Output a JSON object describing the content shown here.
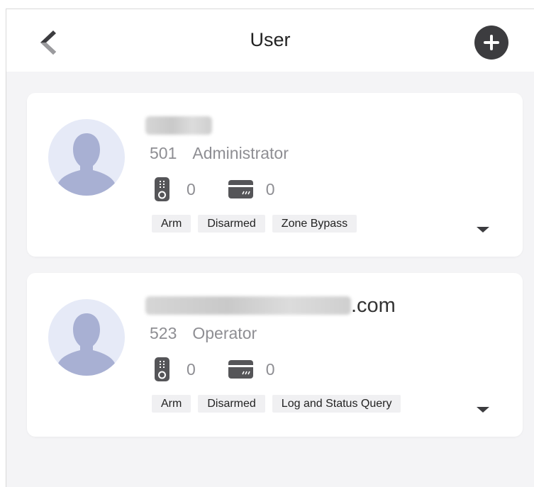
{
  "header": {
    "title": "User"
  },
  "users": [
    {
      "name_suffix": "",
      "id": "501",
      "role": "Administrator",
      "remote_count": "0",
      "card_count": "0",
      "permissions": [
        "Arm",
        "Disarmed",
        "Zone Bypass"
      ]
    },
    {
      "name_suffix": ".com",
      "id": "523",
      "role": "Operator",
      "remote_count": "0",
      "card_count": "0",
      "permissions": [
        "Arm",
        "Disarmed",
        "Log and Status Query"
      ]
    }
  ],
  "icons": {
    "back": "back-chevron-icon",
    "add": "plus-icon",
    "remote": "remote-control-icon",
    "card": "card-icon",
    "expand": "caret-down-icon",
    "avatar": "user-silhouette-icon"
  },
  "colors": {
    "background": "#f4f4f6",
    "card": "#ffffff",
    "avatar_bg": "#e6eaf7",
    "avatar_figure": "#a8b0d3",
    "icon_dark": "#3c3c3f",
    "secondary_text": "#8e8e93",
    "tag_bg": "#f0f0f2"
  }
}
